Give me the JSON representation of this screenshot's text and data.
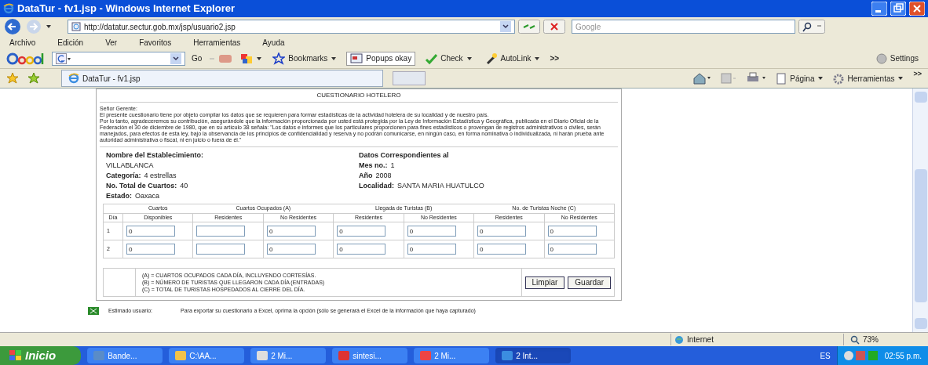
{
  "window": {
    "title": "DataTur - fv1.jsp - Windows Internet Explorer"
  },
  "address_bar": {
    "url": "http://datatur.sectur.gob.mx/jsp/usuario2.jsp",
    "search_placeholder": "Google"
  },
  "menu": [
    "Archivo",
    "Edición",
    "Ver",
    "Favoritos",
    "Herramientas",
    "Ayuda"
  ],
  "google_toolbar": {
    "go": "Go",
    "items": [
      "Bookmarks",
      "Popups okay",
      "Check",
      "AutoLink"
    ],
    "more": ">>",
    "settings": "Settings"
  },
  "tab": {
    "title": "DataTur - fv1.jsp"
  },
  "command_bar": {
    "items": [
      "Página",
      "Herramientas"
    ],
    "more": ">>"
  },
  "form": {
    "title": "CUESTIONARIO HOTELERO",
    "intro": [
      "Señor Gerente:",
      "El presente cuestionario tiene por objeto compilar los datos que se requieren para formar estadísticas de la actividad hotelera de su localidad y de nuestro país.",
      "Por lo tanto, agradeceremos su contribución, asegurándole que la información proporcionada por usted está protegida por la Ley de Información Estadística y Geográfica, publicada en el Diario Oficial de la Federación el 30 de diciembre de 1980, que en su artículo 38 señala: \"Los datos e informes que los particulares proporcionen para fines estadísticos o provengan de registros administrativos o civiles, serán manejados, para efectos de esta ley, bajo la observancia de los principios de confidencialidad y reserva y no podrán comunicarse, en ningún caso, en forma nominativa o individualizada, ni harán prueba ante autoridad administrativa o fiscal, ni en juicio o fuera de él.\""
    ],
    "left": [
      {
        "kind": "stacked",
        "label": "Nombre del Establecimiento:",
        "value": "VILLABLANCA"
      },
      {
        "kind": "inline",
        "label": "Categoría:",
        "value": "4 estrellas"
      },
      {
        "kind": "inline",
        "label": "No. Total de Cuartos:",
        "value": "40"
      },
      {
        "kind": "inline",
        "label": "Estado:",
        "value": "Oaxaca"
      }
    ],
    "right": [
      {
        "kind": "heading",
        "label": "Datos Correspondientes al"
      },
      {
        "kind": "inline",
        "label": "Mes no.:",
        "value": "1"
      },
      {
        "kind": "inline",
        "label": "Año",
        "value": "2008"
      },
      {
        "kind": "inline",
        "label": "Localidad:",
        "value": "SANTA MARIA HUATULCO"
      }
    ],
    "group_headers": [
      "Cuartos",
      "Cuartos Ocupados (A)",
      "Llegada de Turistas (B)",
      "No. de Turistas Noche (C)"
    ],
    "columns": [
      "Día",
      "Disponibles",
      "Residentes",
      "No Residentes",
      "Residentes",
      "No Residentes",
      "Residentes",
      "No Residentes"
    ],
    "rows": [
      {
        "day": "1",
        "disponibles": "0",
        "ocupados_no_residentes": "0",
        "llegada_residentes": "0",
        "llegada_no_residentes": "0",
        "noche_residentes": "0",
        "noche_no_residentes": "0"
      },
      {
        "day": "2",
        "disponibles": "0",
        "ocupados_no_residentes": "0",
        "llegada_residentes": "0",
        "llegada_no_residentes": "0",
        "noche_residentes": "0",
        "noche_no_residentes": "0"
      }
    ],
    "legend": [
      "(A) = CUARTOS OCUPADOS CADA DÍA, INCLUYENDO CORTESÍAS.",
      "(B) = NÚMERO DE TURISTAS QUE LLEGARON CADA DÍA (ENTRADAS)",
      "(C) = TOTAL DE TURISTAS HOSPEDADOS AL CIERRE DEL DÍA."
    ],
    "buttons": [
      "Limpiar",
      "Guardar"
    ]
  },
  "export_note": {
    "label": "Estimado usuario:",
    "text": "Para exportar su cuestionario a Excel, oprima la opción (sólo se generará el Excel de la información que haya capturado)"
  },
  "status_bar": {
    "zone": "Internet",
    "zoom": "73%"
  },
  "taskbar": {
    "start": "Inicio",
    "items": [
      {
        "label": "Bande...",
        "selected": false
      },
      {
        "label": "C:\\AA...",
        "selected": false
      },
      {
        "label": "2 Mi...",
        "selected": false
      },
      {
        "label": "sintesi...",
        "selected": false
      },
      {
        "label": "2 Mi...",
        "selected": false
      },
      {
        "label": "2 Int...",
        "selected": true
      }
    ],
    "language": "ES",
    "clock": "02:55 p.m."
  }
}
